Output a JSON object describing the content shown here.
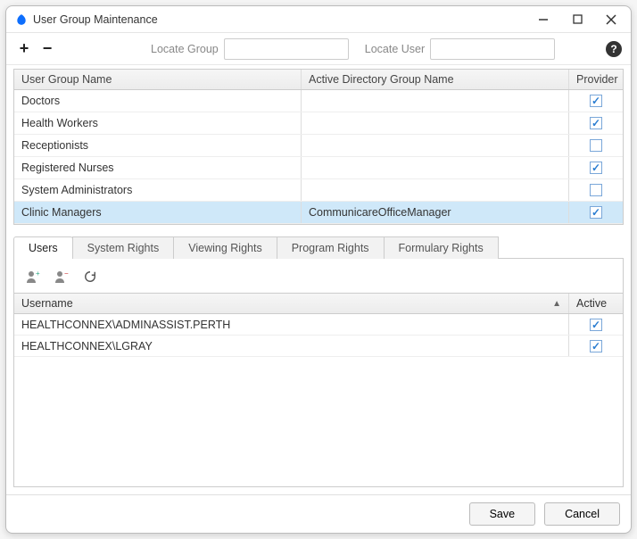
{
  "window": {
    "title": "User Group Maintenance"
  },
  "toolbar": {
    "locate_group_label": "Locate Group",
    "locate_group_value": "",
    "locate_user_label": "Locate User",
    "locate_user_value": ""
  },
  "groups_grid": {
    "columns": {
      "name": "User Group Name",
      "ad_group": "Active Directory Group Name",
      "provider": "Provider"
    },
    "rows": [
      {
        "name": "Doctors",
        "ad_group": "",
        "provider": true,
        "selected": false
      },
      {
        "name": "Health Workers",
        "ad_group": "",
        "provider": true,
        "selected": false
      },
      {
        "name": "Receptionists",
        "ad_group": "",
        "provider": false,
        "selected": false
      },
      {
        "name": "Registered Nurses",
        "ad_group": "",
        "provider": true,
        "selected": false
      },
      {
        "name": "System Administrators",
        "ad_group": "",
        "provider": false,
        "selected": false
      },
      {
        "name": "Clinic Managers",
        "ad_group": "CommunicareOfficeManager",
        "provider": true,
        "selected": true
      }
    ]
  },
  "tabs": [
    {
      "label": "Users",
      "active": true
    },
    {
      "label": "System Rights",
      "active": false
    },
    {
      "label": "Viewing Rights",
      "active": false
    },
    {
      "label": "Program Rights",
      "active": false
    },
    {
      "label": "Formulary Rights",
      "active": false
    }
  ],
  "users_panel": {
    "columns": {
      "username": "Username",
      "active": "Active"
    },
    "sort_asc": true,
    "rows": [
      {
        "username": "HEALTHCONNEX\\ADMINASSIST.PERTH",
        "active": true
      },
      {
        "username": "HEALTHCONNEX\\LGRAY",
        "active": true
      }
    ]
  },
  "footer": {
    "save": "Save",
    "cancel": "Cancel"
  }
}
